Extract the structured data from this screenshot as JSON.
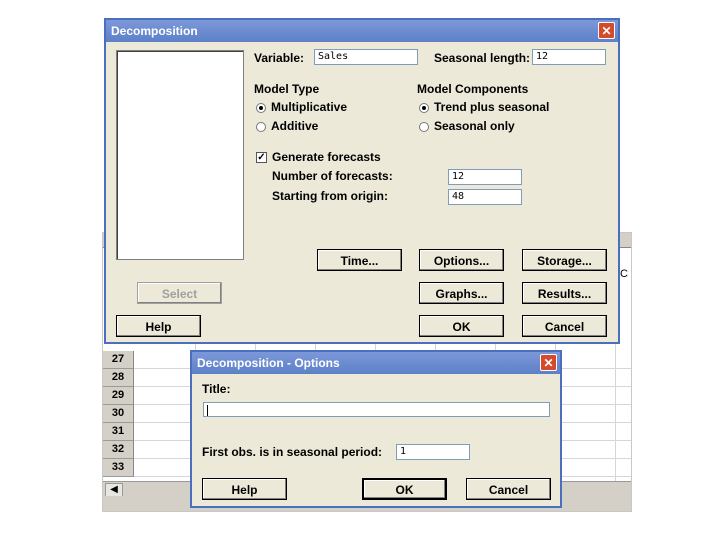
{
  "sheet": {
    "row_numbers": [
      "27",
      "28",
      "29",
      "30",
      "31",
      "32",
      "33"
    ],
    "col_c_fragment": "C"
  },
  "main_dialog": {
    "title": "Decomposition",
    "close": "✕",
    "variable_label": "Variable:",
    "variable_value": "Sales",
    "seasonal_length_label": "Seasonal length:",
    "seasonal_length_value": "12",
    "model_type": {
      "heading": "Model Type",
      "options": [
        {
          "label": "Multiplicative",
          "selected": true
        },
        {
          "label": "Additive",
          "selected": false
        }
      ]
    },
    "model_components": {
      "heading": "Model Components",
      "options": [
        {
          "label": "Trend plus seasonal",
          "selected": true
        },
        {
          "label": "Seasonal only",
          "selected": false
        }
      ]
    },
    "generate_forecasts": {
      "label": "Generate forecasts",
      "checked": true,
      "mark": "✓"
    },
    "num_forecasts_label": "Number of forecasts:",
    "num_forecasts_value": "12",
    "starting_origin_label": "Starting from origin:",
    "starting_origin_value": "48",
    "buttons": {
      "time": "Time...",
      "options": "Options...",
      "storage": "Storage...",
      "select": "Select",
      "graphs": "Graphs...",
      "results": "Results...",
      "help": "Help",
      "ok": "OK",
      "cancel": "Cancel"
    }
  },
  "options_dialog": {
    "title": "Decomposition - Options",
    "close": "✕",
    "title_label": "Title:",
    "title_value": "",
    "first_obs_label": "First obs. is in seasonal period:",
    "first_obs_value": "1",
    "buttons": {
      "help": "Help",
      "ok": "OK",
      "cancel": "Cancel"
    }
  }
}
